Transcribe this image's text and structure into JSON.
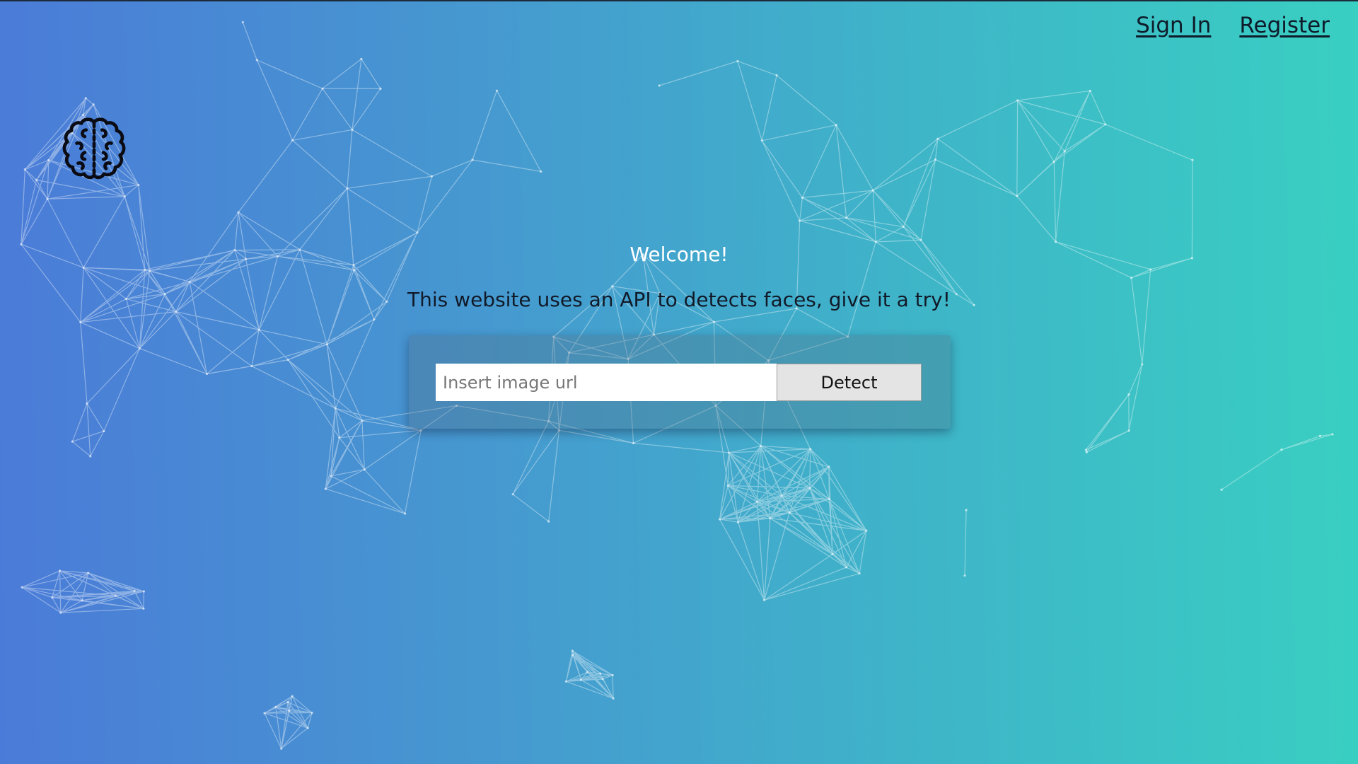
{
  "nav": {
    "sign_in": "Sign In",
    "register": "Register"
  },
  "logo": {
    "icon": "brain-icon"
  },
  "main": {
    "welcome": "Welcome!",
    "tagline": "This website uses an API to detects faces, give it a try!"
  },
  "form": {
    "url_placeholder": "Insert image url",
    "url_value": "",
    "detect_label": "Detect"
  },
  "colors": {
    "gradient_start": "#4b7bd8",
    "gradient_end": "#39cfc2",
    "network_lines": "#ffffff"
  }
}
